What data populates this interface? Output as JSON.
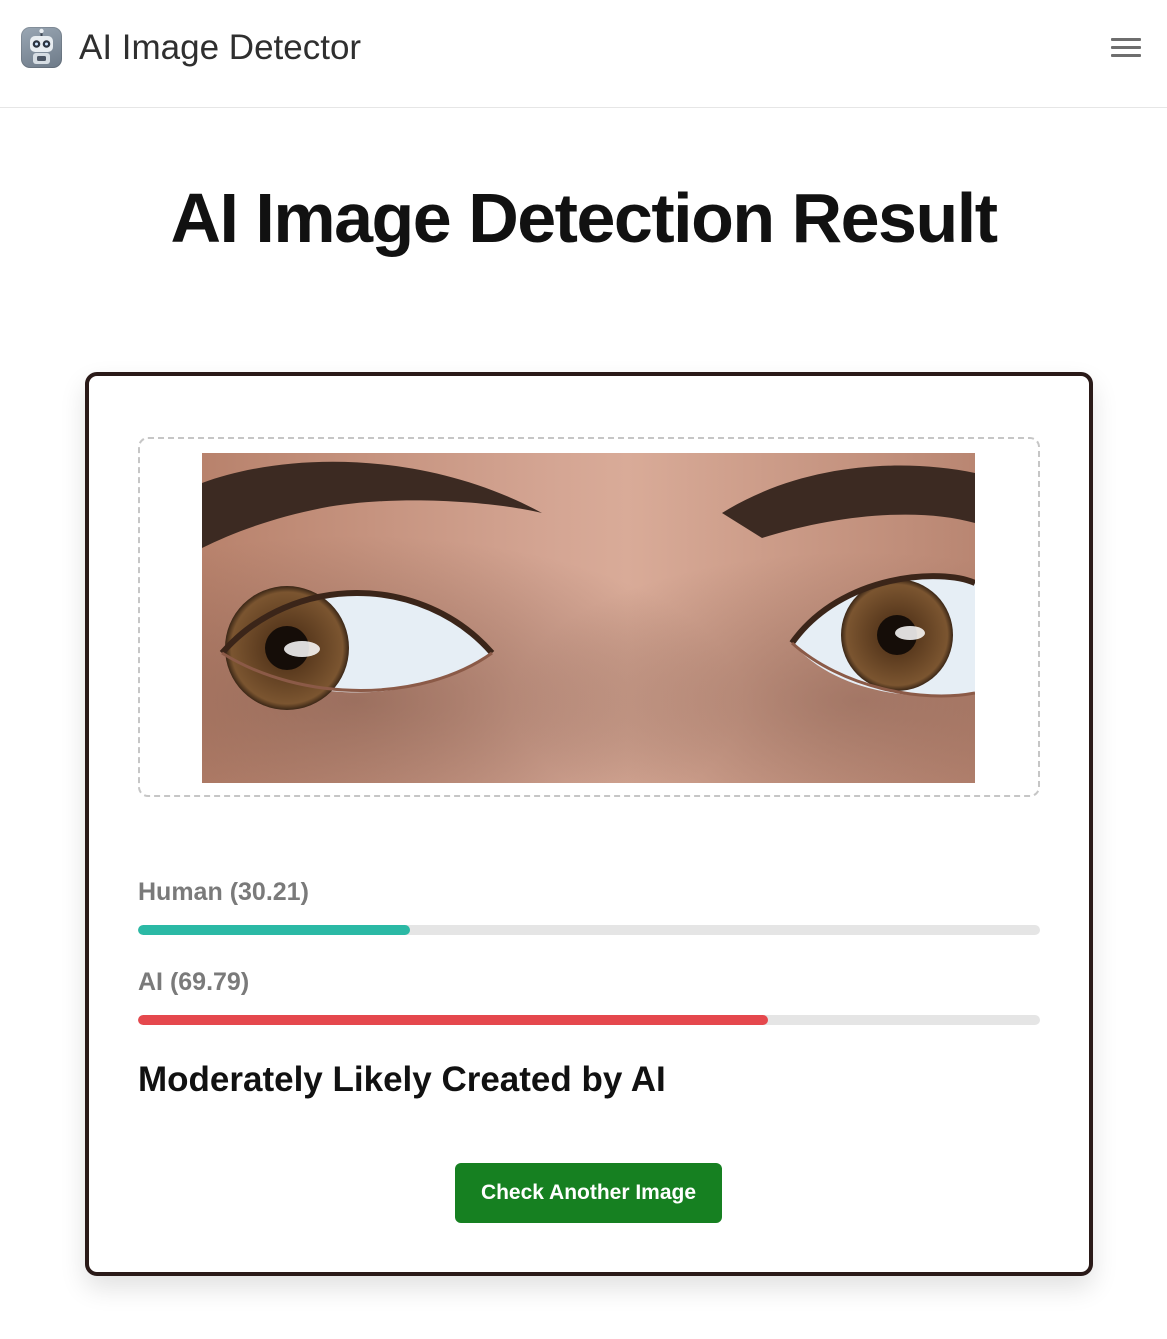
{
  "header": {
    "brand": "AI Image Detector",
    "logo_icon": "robot-icon",
    "menu_icon": "hamburger-menu-icon"
  },
  "page": {
    "title": "AI Image Detection Result"
  },
  "result": {
    "image_description": "Close-up photo of a person's eyes and eyebrows",
    "scores": [
      {
        "label": "Human",
        "value": "(30.21)",
        "percent": 30.21,
        "color": "#2bb9a5"
      },
      {
        "label": "AI",
        "value": "(69.79)",
        "percent": 69.79,
        "color": "#e5484d"
      }
    ],
    "verdict": "Moderately Likely Created by AI",
    "button_label": "Check Another Image",
    "button_color": "#168021"
  }
}
